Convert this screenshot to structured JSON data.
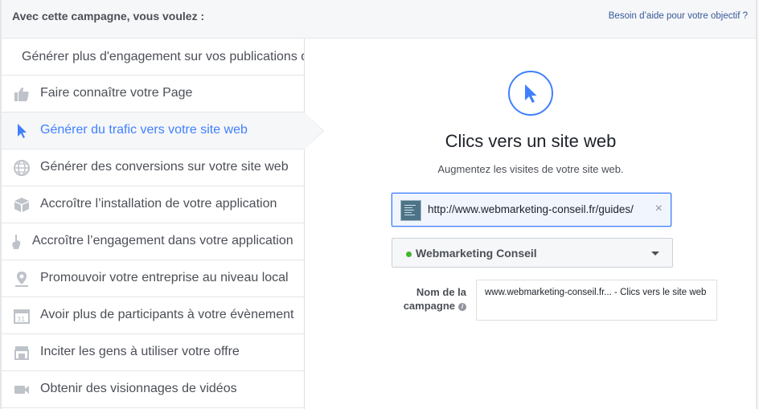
{
  "header": {
    "title": "Avec cette campagne, vous voulez :",
    "help_link": "Besoin d’aide pour votre objectif ?"
  },
  "sidebar": {
    "items": [
      {
        "label": "Générer plus d'engagement sur vos publications de votre Page",
        "icon": "none"
      },
      {
        "label": "Faire connaître votre Page",
        "icon": "thumbs-up-icon"
      },
      {
        "label": "Générer du trafic vers votre site web",
        "icon": "cursor-icon",
        "selected": true
      },
      {
        "label": "Générer des conversions sur votre site web",
        "icon": "globe-icon"
      },
      {
        "label": "Accroître l’installation de votre application",
        "icon": "box-icon"
      },
      {
        "label": "Accroître l’engagement dans votre application",
        "icon": "hand-icon"
      },
      {
        "label": "Promouvoir votre entreprise au niveau local",
        "icon": "map-pin-icon"
      },
      {
        "label": "Avoir plus de participants à votre évènement",
        "icon": "calendar-icon"
      },
      {
        "label": "Inciter les gens à utiliser votre offre",
        "icon": "store-icon"
      },
      {
        "label": "Obtenir des visionnages de vidéos",
        "icon": "video-camera-icon"
      }
    ]
  },
  "main": {
    "objective_icon": "cursor-icon",
    "title": "Clics vers un site web",
    "subtitle": "Augmentez les visites de votre site web.",
    "url": {
      "value": "http://www.webmarketing-conseil.fr/guides/",
      "clear_icon": "close-icon"
    },
    "page_selector": {
      "selected": "Webmarketing Conseil",
      "status_color": "#42b72a"
    },
    "campaign": {
      "label": "Nom de la campagne",
      "value": "www.webmarketing-conseil.fr... - Clics vers le site web"
    }
  },
  "colors": {
    "accent": "#4080ff",
    "link": "#365899",
    "text_muted": "#4b4f56"
  }
}
